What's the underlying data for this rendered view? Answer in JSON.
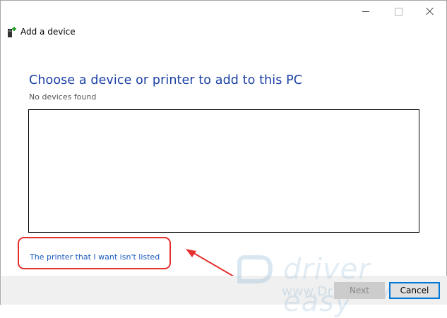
{
  "window": {
    "title": "Add a device"
  },
  "main": {
    "heading": "Choose a device or printer to add to this PC",
    "status": "No devices found"
  },
  "link": {
    "text": "The printer that I want isn't listed"
  },
  "buttons": {
    "next": "Next",
    "cancel": "Cancel"
  },
  "watermark": {
    "brand": "driver easy",
    "url": "www.DriverEasy.com"
  },
  "colors": {
    "heading": "#1a3fa4",
    "link": "#1a5bbf",
    "highlight": "#e53030",
    "focus": "#0078d7"
  },
  "icons": {
    "window": "device-plus-icon",
    "caption": [
      "minimize-icon",
      "maximize-icon",
      "close-icon"
    ]
  }
}
